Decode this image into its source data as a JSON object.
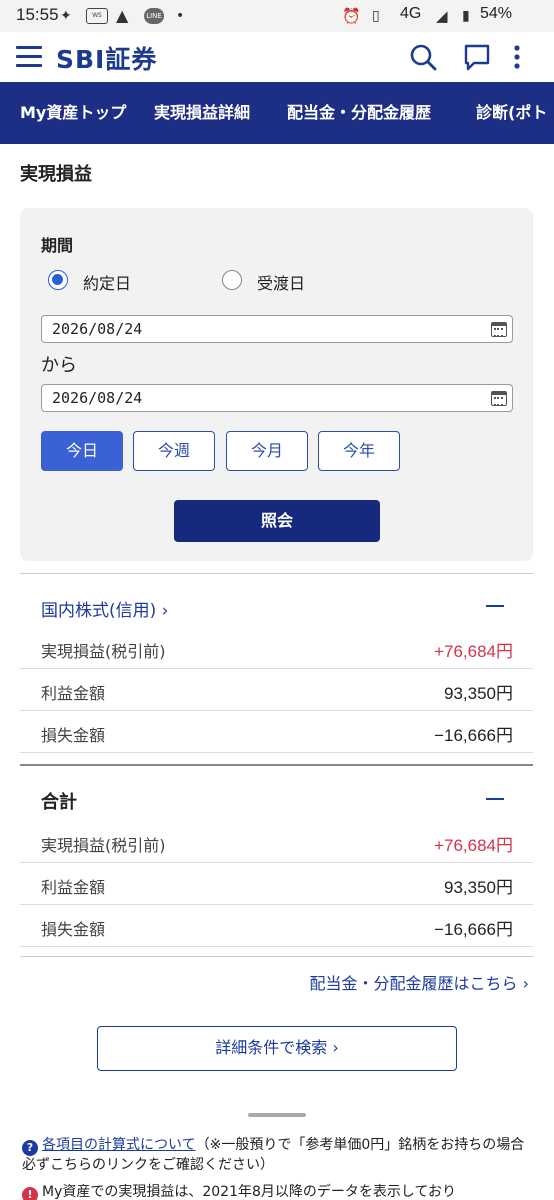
{
  "status_bar": {
    "time": "15:55",
    "network": "4G",
    "battery": "54%",
    "icons": [
      "sparkle-icon",
      "westen-icon",
      "warning-icon",
      "line-app-icon",
      "dot-icon",
      "alarm-icon",
      "vibrate-icon",
      "signal-icon",
      "battery-icon"
    ]
  },
  "header": {
    "logo": "SBI証券",
    "icons": [
      "menu-icon",
      "search-icon",
      "chat-icon",
      "more-vertical-icon"
    ]
  },
  "nav": {
    "tabs": [
      "My資産トップ",
      "実現損益詳細",
      "配当金・分配金履歴",
      "診断(ポト"
    ]
  },
  "page": {
    "title": "実現損益"
  },
  "filter": {
    "period_label": "期間",
    "radio_options": [
      {
        "label": "約定日",
        "checked": true
      },
      {
        "label": "受渡日",
        "checked": false
      }
    ],
    "from_date": "2026/08/24",
    "from_label": "から",
    "to_date": "2026/08/24",
    "quick_buttons": [
      "今日",
      "今週",
      "今月",
      "今年"
    ],
    "active_quick": "今日",
    "submit_label": "照会"
  },
  "groups": [
    {
      "title": "国内株式(信用) ›",
      "rows": [
        {
          "label": "実現損益(税引前)",
          "value": "+76,684円"
        },
        {
          "label": "利益金額",
          "value": "93,350円"
        },
        {
          "label": "損失金額",
          "value": "−16,666円"
        }
      ]
    },
    {
      "title": "合計",
      "rows": [
        {
          "label": "実現損益(税引前)",
          "value": "+76,684円"
        },
        {
          "label": "利益金額",
          "value": "93,350円"
        },
        {
          "label": "損失金額",
          "value": "−16,666円"
        }
      ]
    }
  ],
  "links": {
    "dividend": "配当金・分配金履歴はこちら ›",
    "detail_search": "詳細条件で検索 ›"
  },
  "notes": {
    "formula_link": "各項目の計算式について",
    "formula_text": "（※一般預りで「参考単価0円」銘柄をお持ちの場合必ずこちらのリンクをご確認ください）",
    "warning_text": "My資産での実現損益は、2021年8月以降のデータを表示しており"
  },
  "colors": {
    "brand": "#1c3a8f",
    "nav_bg": "#1d2f85",
    "positive": "#d4334a",
    "active_button": "#3b62d4"
  }
}
